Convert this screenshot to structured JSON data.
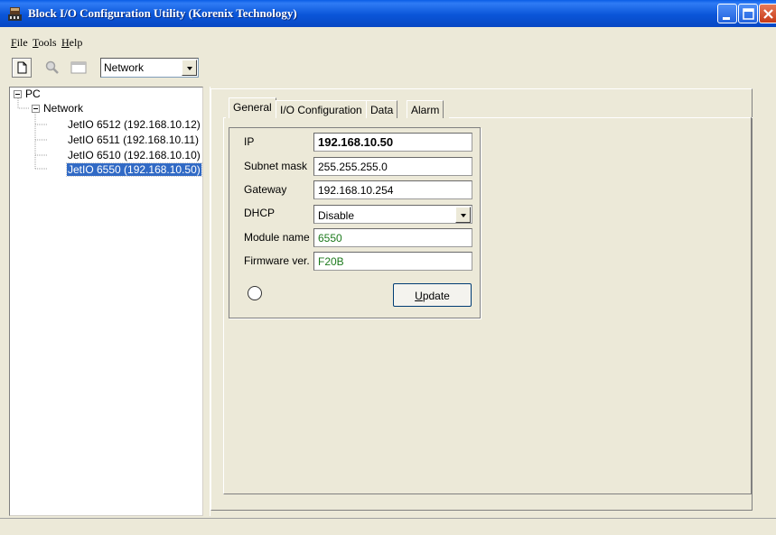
{
  "window": {
    "title": "Block I/O Configuration Utility (Korenix Technology)",
    "icon": "app-icon"
  },
  "menu": {
    "items": [
      {
        "label": "File"
      },
      {
        "label": "Tools"
      },
      {
        "label": "Help"
      }
    ]
  },
  "toolbar": {
    "buttons": [
      "new-icon",
      "search-icon",
      "window-icon"
    ],
    "view_select": "Network"
  },
  "tree": {
    "root": "PC",
    "network": "Network",
    "devices": [
      {
        "label": "JetIO 6512 (192.168.10.12)"
      },
      {
        "label": "JetIO 6511 (192.168.10.11)"
      },
      {
        "label": "JetIO 6510 (192.168.10.10)"
      },
      {
        "label": "JetIO 6550 (192.168.10.50)",
        "selected": true
      }
    ]
  },
  "tabs": [
    {
      "label": "General",
      "active": true
    },
    {
      "label": "I/O Configuration"
    },
    {
      "label": "Data"
    },
    {
      "label": "Alarm"
    }
  ],
  "general": {
    "ip_label": "IP",
    "ip_value": "192.168.10.50",
    "subnet_label": "Subnet mask",
    "subnet_value": "255.255.255.0",
    "gateway_label": "Gateway",
    "gateway_value": "192.168.10.254",
    "dhcp_label": "DHCP",
    "dhcp_value": "Disable",
    "module_label": "Module name",
    "module_value": "6550",
    "firmware_label": "Firmware ver.",
    "firmware_value": "F20B",
    "update_label": "Update"
  },
  "colors": {
    "titlebar": "#0a55d8",
    "selection": "#316ac5",
    "readonly_text": "#1d7a1d",
    "background": "#ece9d8"
  }
}
